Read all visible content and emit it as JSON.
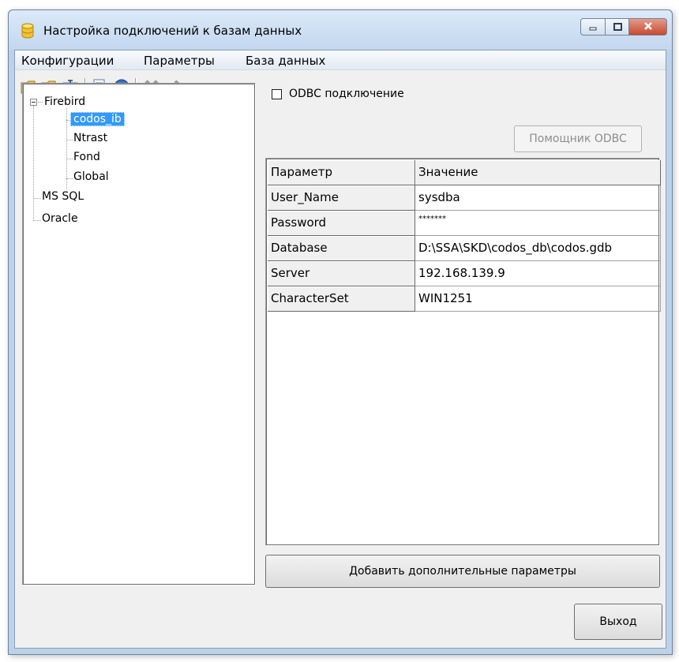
{
  "window": {
    "title": "Настройка подключений к базам данных",
    "accent": "#bcd1ea"
  },
  "menu": {
    "items": [
      {
        "label": "Конфигурации"
      },
      {
        "label": "Параметры"
      },
      {
        "label": "База данных"
      }
    ]
  },
  "toolbar": {
    "buttons": [
      {
        "icon": "folder-add-icon"
      },
      {
        "icon": "folder-delete-icon"
      },
      {
        "icon": "rename-icon"
      },
      {
        "icon": "document-add-icon"
      },
      {
        "icon": "test-connection-icon"
      },
      {
        "icon": "cancel-icon",
        "disabled": true
      },
      {
        "icon": "apply-icon",
        "disabled": true
      }
    ]
  },
  "tree": {
    "nodes": [
      {
        "label": "Firebird",
        "expanded": true,
        "children": [
          {
            "label": "codos_ib",
            "selected": true
          },
          {
            "label": "Ntrast"
          },
          {
            "label": "Fond"
          },
          {
            "label": "Global"
          }
        ]
      },
      {
        "label": "MS SQL"
      },
      {
        "label": "Oracle"
      }
    ]
  },
  "odbc": {
    "checkbox_label": "ODBC подключение",
    "checked": false,
    "helper_button": "Помощник ODBC"
  },
  "grid": {
    "headers": [
      "Параметр",
      "Значение"
    ],
    "rows": [
      [
        "User_Name",
        "sysdba"
      ],
      [
        "Password",
        "*******"
      ],
      [
        "Database",
        "D:\\SSA\\SKD\\codos_db\\codos.gdb"
      ],
      [
        "Server",
        "192.168.139.9"
      ],
      [
        "CharacterSet",
        "WIN1251"
      ]
    ]
  },
  "buttons": {
    "add_params": "Добавить дополнительные параметры",
    "exit": "Выход"
  }
}
